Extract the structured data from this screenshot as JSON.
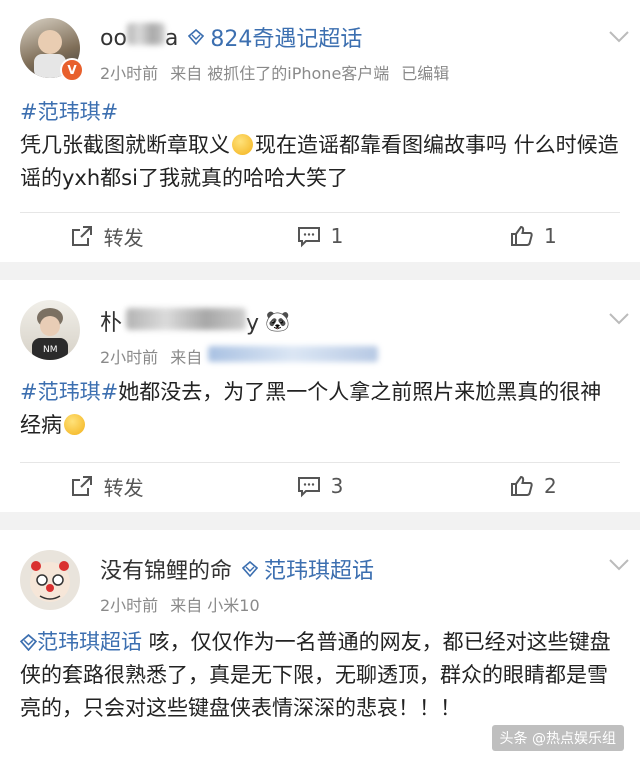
{
  "colors": {
    "link": "#3c6fb0",
    "meta": "#8a8a8a",
    "badge": "#e8602d"
  },
  "posts": [
    {
      "username_visible": "oo",
      "username_tail": "a",
      "super_topic": "824奇遇记超话",
      "badge": "V",
      "time": "2小时前",
      "source": "来自 被抓住了的iPhone客户端",
      "edited": "已编辑",
      "hashtag": "#范玮琪#",
      "text1": "凭几张截图就断章取义",
      "text2": "现在造谣都靠看图编故事吗 什么时候造谣的yxh都si了我就真的哈哈大笑了",
      "repost_label": "转发",
      "comment_count": "1",
      "like_count": "1"
    },
    {
      "username_visible": "朴",
      "username_tail": "y",
      "name_emoji": "🐼",
      "time": "2小时前",
      "source_prefix": "来自",
      "hashtag": "#范玮琪#",
      "text1": "她都没去，为了黑一个人拿之前照片来尬黑真的很神经病",
      "repost_label": "转发",
      "comment_count": "3",
      "like_count": "2"
    },
    {
      "username": "没有锦鲤的命",
      "super_topic": "范玮琪超话",
      "time": "2小时前",
      "source": "来自 小米10",
      "topic_link": "范玮琪超话",
      "text1": " 咳，仅仅作为一名普通的网友，都已经对这些键盘侠的套路很熟悉了，真是无下限，无聊透顶，群众的眼睛都是雪亮的，只会对这些键盘侠表情深深的悲哀！！！"
    }
  ],
  "watermark": "头条 @热点娱乐组"
}
